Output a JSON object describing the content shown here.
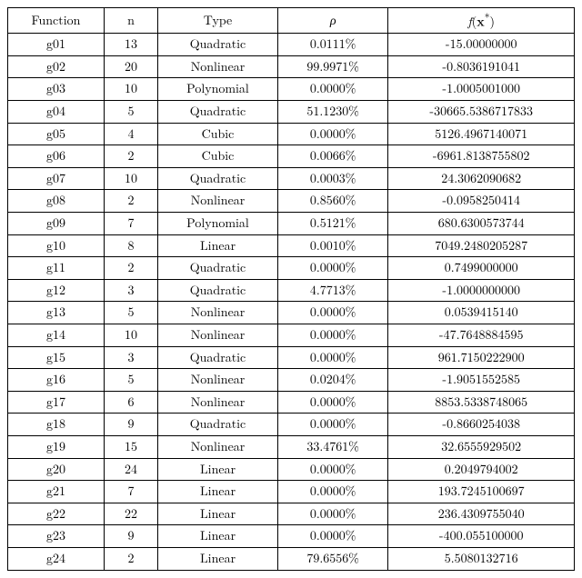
{
  "chart_data": {
    "type": "table",
    "headers": {
      "function": "Function",
      "n": "n",
      "type": "Type",
      "rho": "ρ",
      "fx_prefix": "f",
      "fx_arg": "x",
      "fx_sup": "*"
    },
    "rows": [
      {
        "function": "g01",
        "n": "13",
        "type": "Quadratic",
        "rho": "0.0111%",
        "fx": "-15.00000000"
      },
      {
        "function": "g02",
        "n": "20",
        "type": "Nonlinear",
        "rho": "99.9971%",
        "fx": "-0.8036191041"
      },
      {
        "function": "g03",
        "n": "10",
        "type": "Polynomial",
        "rho": "0.0000%",
        "fx": "-1.0005001000"
      },
      {
        "function": "g04",
        "n": "5",
        "type": "Quadratic",
        "rho": "51.1230%",
        "fx": "-30665.5386717833"
      },
      {
        "function": "g05",
        "n": "4",
        "type": "Cubic",
        "rho": "0.0000%",
        "fx": "5126.4967140071"
      },
      {
        "function": "g06",
        "n": "2",
        "type": "Cubic",
        "rho": "0.0066%",
        "fx": "-6961.8138755802"
      },
      {
        "function": "g07",
        "n": "10",
        "type": "Quadratic",
        "rho": "0.0003%",
        "fx": "24.3062090682"
      },
      {
        "function": "g08",
        "n": "2",
        "type": "Nonlinear",
        "rho": "0.8560%",
        "fx": "-0.0958250414"
      },
      {
        "function": "g09",
        "n": "7",
        "type": "Polynomial",
        "rho": "0.5121%",
        "fx": "680.6300573744"
      },
      {
        "function": "g10",
        "n": "8",
        "type": "Linear",
        "rho": "0.0010%",
        "fx": "7049.2480205287"
      },
      {
        "function": "g11",
        "n": "2",
        "type": "Quadratic",
        "rho": "0.0000%",
        "fx": "0.7499000000"
      },
      {
        "function": "g12",
        "n": "3",
        "type": "Quadratic",
        "rho": "4.7713%",
        "fx": "-1.0000000000"
      },
      {
        "function": "g13",
        "n": "5",
        "type": "Nonlinear",
        "rho": "0.0000%",
        "fx": "0.0539415140"
      },
      {
        "function": "g14",
        "n": "10",
        "type": "Nonlinear",
        "rho": "0.0000%",
        "fx": "-47.7648884595"
      },
      {
        "function": "g15",
        "n": "3",
        "type": "Quadratic",
        "rho": "0.0000%",
        "fx": "961.7150222900"
      },
      {
        "function": "g16",
        "n": "5",
        "type": "Nonlinear",
        "rho": "0.0204%",
        "fx": "-1.9051552585"
      },
      {
        "function": "g17",
        "n": "6",
        "type": "Nonlinear",
        "rho": "0.0000%",
        "fx": "8853.5338748065"
      },
      {
        "function": "g18",
        "n": "9",
        "type": "Quadratic",
        "rho": "0.0000%",
        "fx": "-0.8660254038"
      },
      {
        "function": "g19",
        "n": "15",
        "type": "Nonlinear",
        "rho": "33.4761%",
        "fx": "32.6555929502"
      },
      {
        "function": "g20",
        "n": "24",
        "type": "Linear",
        "rho": "0.0000%",
        "fx": "0.2049794002"
      },
      {
        "function": "g21",
        "n": "7",
        "type": "Linear",
        "rho": "0.0000%",
        "fx": "193.7245100697"
      },
      {
        "function": "g22",
        "n": "22",
        "type": "Linear",
        "rho": "0.0000%",
        "fx": "236.4309755040"
      },
      {
        "function": "g23",
        "n": "9",
        "type": "Linear",
        "rho": "0.0000%",
        "fx": "-400.055100000"
      },
      {
        "function": "g24",
        "n": "2",
        "type": "Linear",
        "rho": "79.6556%",
        "fx": "5.5080132716"
      }
    ]
  }
}
